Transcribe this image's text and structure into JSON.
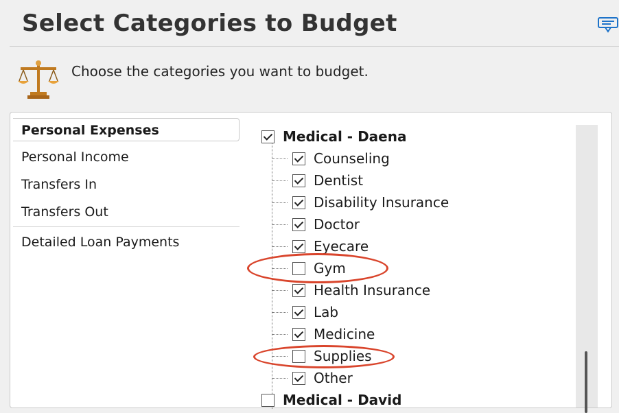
{
  "header": {
    "title": "Select Categories to Budget",
    "instruction": "Choose the categories you want to budget."
  },
  "icons": {
    "scales": "scales-icon",
    "corner": "message-icon"
  },
  "left_list": {
    "items": [
      {
        "label": "Personal Expenses",
        "selected": true
      },
      {
        "label": "Personal Income",
        "selected": false
      },
      {
        "label": "Transfers In",
        "selected": false
      },
      {
        "label": "Transfers Out",
        "selected": false
      },
      {
        "label": "Detailed Loan Payments",
        "selected": false
      }
    ]
  },
  "tree": {
    "parent": {
      "label": "Medical - Daena",
      "checked": true
    },
    "children": [
      {
        "label": "Counseling",
        "checked": true
      },
      {
        "label": "Dentist",
        "checked": true
      },
      {
        "label": "Disability Insurance",
        "checked": true
      },
      {
        "label": "Doctor",
        "checked": true
      },
      {
        "label": "Eyecare",
        "checked": true
      },
      {
        "label": "Gym",
        "checked": false
      },
      {
        "label": "Health Insurance",
        "checked": true
      },
      {
        "label": "Lab",
        "checked": true
      },
      {
        "label": "Medicine",
        "checked": true
      },
      {
        "label": "Supplies",
        "checked": false
      },
      {
        "label": "Other",
        "checked": true
      }
    ],
    "next_parent": {
      "label": "Medical - David",
      "checked": false
    }
  },
  "colors": {
    "annotation": "#d9452c",
    "accent": "#1e73c9"
  }
}
